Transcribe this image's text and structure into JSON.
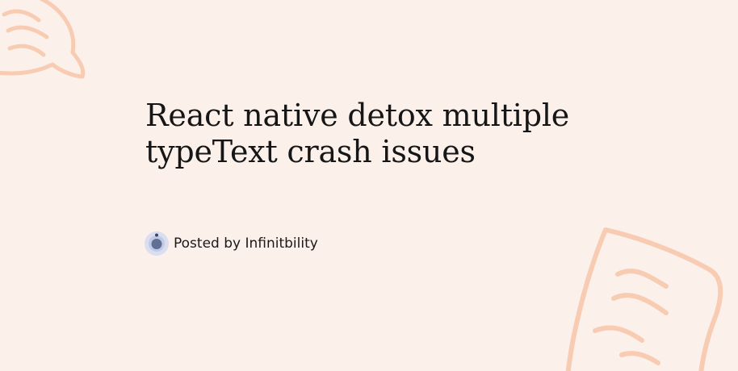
{
  "post": {
    "title": "React native detox multiple typeText crash issues",
    "byline_prefix": "Posted by",
    "author": "Infinitbility"
  },
  "theme": {
    "background": "#fcf0eb",
    "decor_stroke": "#f7c9ae",
    "avatar_outer": "#d9def0",
    "avatar_inner": "#5f6f96",
    "title_color": "#161616"
  },
  "icons": {
    "avatar": "author-avatar-icon",
    "decor_top_left": "doodle-chat-bubble-icon",
    "decor_bottom_right": "doodle-note-icon"
  }
}
